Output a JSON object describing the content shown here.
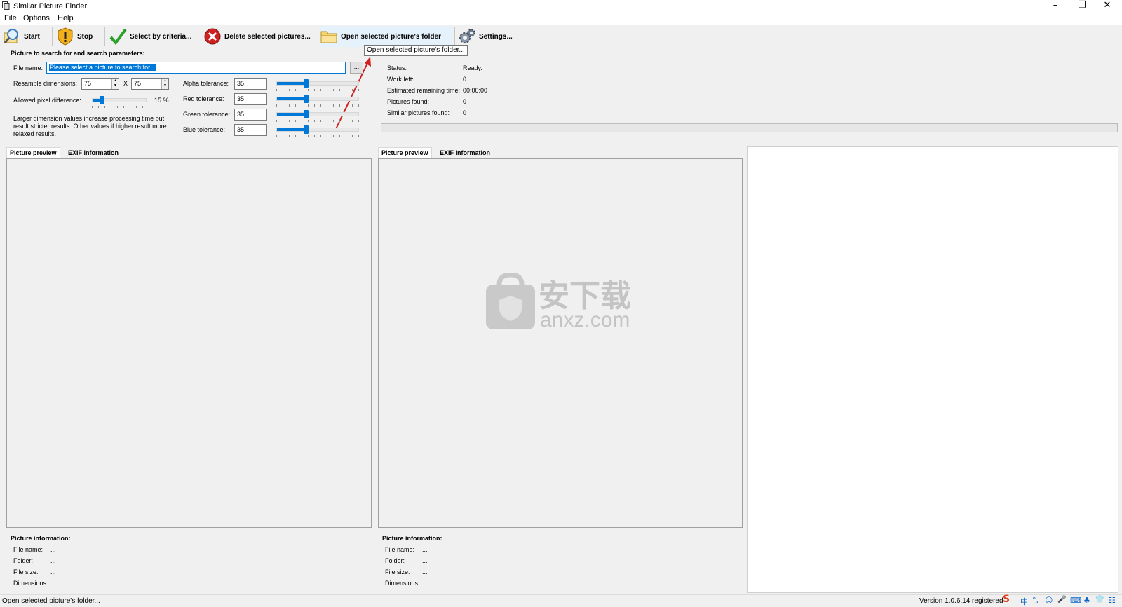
{
  "window": {
    "title": "Similar Picture Finder",
    "minimize": "–",
    "restore": "❐",
    "close": "✕"
  },
  "menu": [
    "File",
    "Options",
    "Help"
  ],
  "toolbar": {
    "start": "Start",
    "stop": "Stop",
    "select": "Select by criteria...",
    "delete": "Delete selected pictures...",
    "open_folder": "Open selected picture's folder",
    "settings": "Settings..."
  },
  "tooltip": "Open selected picture's folder...",
  "search": {
    "group_title": "Picture to search for and search parameters:",
    "file_name_label": "File name:",
    "file_name_value": "Please select a picture to search for...",
    "browse": "...",
    "resample_label": "Resample dimensions:",
    "resample_w": "75",
    "resample_x": "X",
    "resample_h": "75",
    "pixel_diff_label": "Allowed pixel difference:",
    "pixel_diff_value": "15 %",
    "pixel_diff_level": 0.15,
    "hint": "Larger dimension values increase processing time but result stricter results. Other values if higher result more relaxed results.",
    "tolerances": [
      {
        "label": "Alpha tolerance:",
        "value": "35",
        "level": 0.35
      },
      {
        "label": "Red tolerance:",
        "value": "35",
        "level": 0.35
      },
      {
        "label": "Green tolerance:",
        "value": "35",
        "level": 0.35
      },
      {
        "label": "Blue tolerance:",
        "value": "35",
        "level": 0.35
      }
    ]
  },
  "status": [
    {
      "label": "Status:",
      "value": "Ready."
    },
    {
      "label": "Work left:",
      "value": "0"
    },
    {
      "label": "Estimated remaining time:",
      "value": "00:00:00"
    },
    {
      "label": "Pictures found:",
      "value": "0"
    },
    {
      "label": "Similar pictures found:",
      "value": "0"
    }
  ],
  "progress_level": 0,
  "tabs": {
    "preview": "Picture preview",
    "exif": "EXIF information"
  },
  "picture_info": {
    "title": "Picture information:",
    "rows": [
      {
        "label": "File name:",
        "value": "..."
      },
      {
        "label": "Folder:",
        "value": "..."
      },
      {
        "label": "File size:",
        "value": "..."
      },
      {
        "label": "Dimensions:",
        "value": "..."
      }
    ]
  },
  "watermark": {
    "cn": "安下载",
    "en": "anxz.com"
  },
  "statusbar": {
    "left": "Open selected picture's folder...",
    "right": "Version 1.0.6.14 registered",
    "tray": [
      "S",
      "中",
      "°,",
      "☺",
      "🎤",
      "⌨",
      "♣",
      "👕",
      "☷"
    ]
  },
  "colors": {
    "accent": "#0078d7",
    "delete": "#cc2222",
    "check": "#2aa02a",
    "arrow": "#d02020"
  }
}
